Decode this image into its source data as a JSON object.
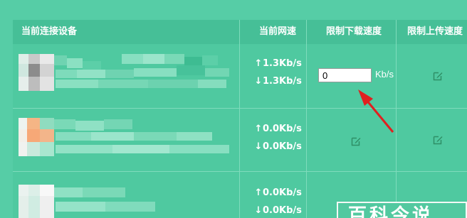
{
  "table": {
    "headers": {
      "device": "当前连接设备",
      "speed": "当前网速",
      "download_limit": "限制下载速度",
      "upload_limit": "限制上传速度"
    },
    "rows": [
      {
        "up": "1.3Kb/s",
        "down": "1.3Kb/s",
        "download_value": "0",
        "unit": "Kb/s"
      },
      {
        "up": "0.0Kb/s",
        "down": "0.0Kb/s"
      },
      {
        "up": "0.0Kb/s",
        "down": "0.0Kb/s"
      }
    ]
  },
  "arrows": {
    "up": "↑",
    "down": "↓"
  },
  "watermark": "百科今说",
  "colors": {
    "background": "#56cda6",
    "header": "#46bf97",
    "annotation": "#e02020"
  },
  "icons": {
    "edit": "edit-icon"
  }
}
